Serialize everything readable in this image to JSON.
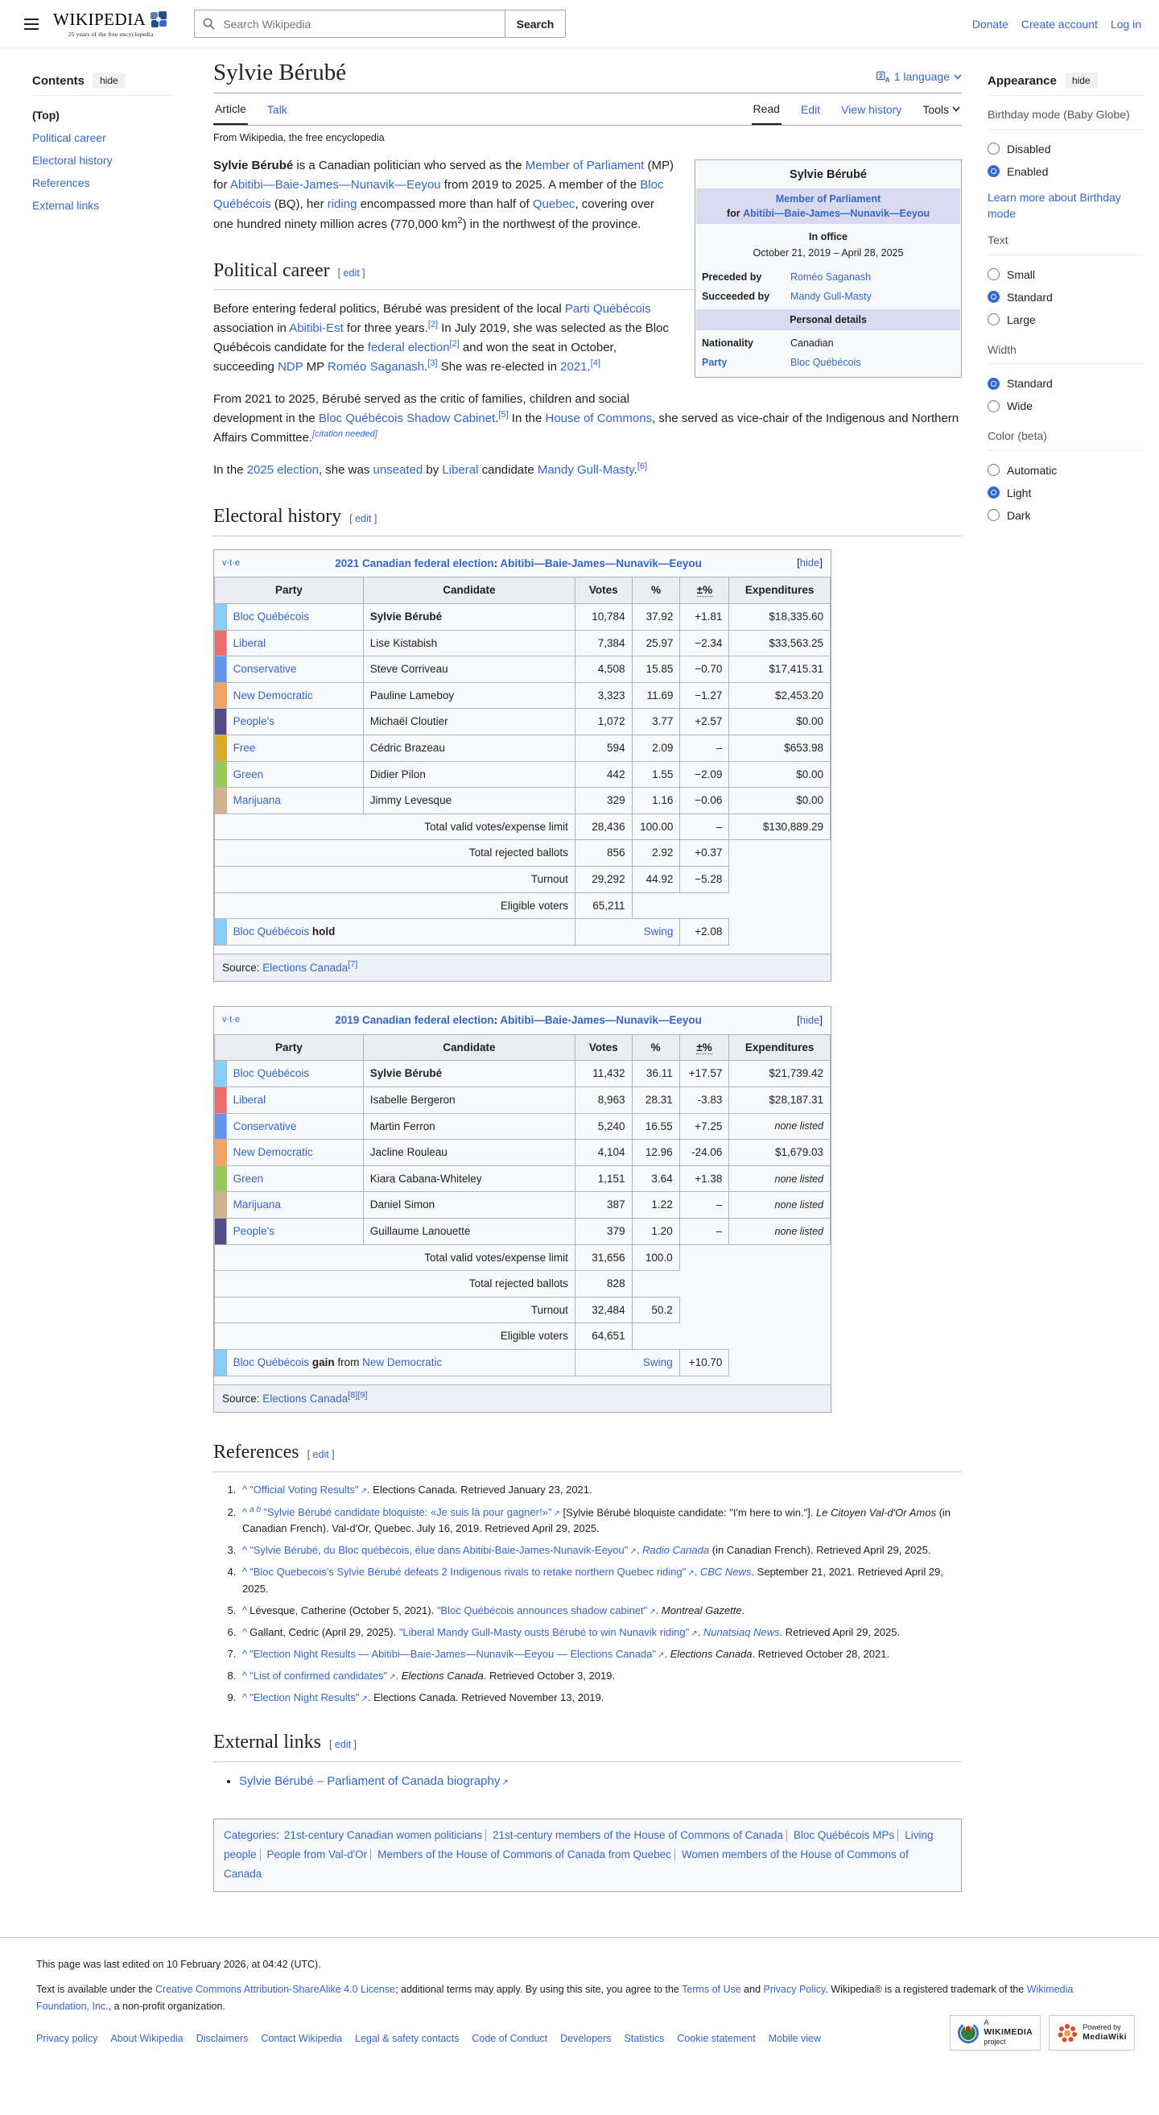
{
  "header": {
    "logo_word": "WIKIPEDIA",
    "logo_tagline": "25 years of the free encyclopedia",
    "search_placeholder": "Search Wikipedia",
    "search_button": "Search",
    "links": [
      "Donate",
      "Create account",
      "Log in"
    ]
  },
  "contents_sidebar": {
    "title": "Contents",
    "hide_label": "hide",
    "items": [
      {
        "label": "(Top)",
        "top": true
      },
      {
        "label": "Political career"
      },
      {
        "label": "Electoral history"
      },
      {
        "label": "References"
      },
      {
        "label": "External links"
      }
    ]
  },
  "article": {
    "title": "Sylvie Bérubé",
    "language_button": "1 language",
    "tabs_left": [
      "Article",
      "Talk"
    ],
    "tabs_right": [
      "Read",
      "Edit",
      "View history",
      "Tools"
    ],
    "subtitle": "From Wikipedia, the free encyclopedia",
    "edit_label": "edit",
    "sections": {
      "political_career": "Political career",
      "electoral_history": "Electoral history",
      "references": "References",
      "external_links": "External links"
    },
    "lead": [
      {
        "t": "b",
        "x": "Sylvie Bérubé"
      },
      {
        "t": "x",
        "x": " is a Canadian politician who served as the "
      },
      {
        "t": "l",
        "x": "Member of Parliament"
      },
      {
        "t": "x",
        "x": " (MP) for "
      },
      {
        "t": "l",
        "x": "Abitibi—Baie-James—Nunavik—Eeyou"
      },
      {
        "t": "x",
        "x": " from 2019 to 2025. A member of the "
      },
      {
        "t": "l",
        "x": "Bloc Québécois"
      },
      {
        "t": "x",
        "x": " (BQ), her "
      },
      {
        "t": "l",
        "x": "riding"
      },
      {
        "t": "x",
        "x": " encompassed more than half of "
      },
      {
        "t": "l",
        "x": "Quebec"
      },
      {
        "t": "x",
        "x": ", covering over one hundred ninety million acres (770,000 km"
      },
      {
        "t": "sp",
        "x": "2"
      },
      {
        "t": "x",
        "x": ") in the northwest of the province."
      }
    ],
    "career_paragraphs": [
      [
        {
          "t": "x",
          "x": "Before entering federal politics, Bérubé was president of the local "
        },
        {
          "t": "l",
          "x": "Parti Québécois"
        },
        {
          "t": "x",
          "x": " association in "
        },
        {
          "t": "l",
          "x": "Abitibi-Est"
        },
        {
          "t": "x",
          "x": " for three years."
        },
        {
          "t": "s",
          "x": "[2]"
        },
        {
          "t": "x",
          "x": " In July 2019, she was selected as the Bloc Québécois candidate for the "
        },
        {
          "t": "l",
          "x": "federal election"
        },
        {
          "t": "s",
          "x": "[2]"
        },
        {
          "t": "x",
          "x": " and won the seat in October, succeeding "
        },
        {
          "t": "l",
          "x": "NDP"
        },
        {
          "t": "x",
          "x": " MP "
        },
        {
          "t": "l",
          "x": "Roméo Saganash"
        },
        {
          "t": "x",
          "x": "."
        },
        {
          "t": "s",
          "x": "[3]"
        },
        {
          "t": "x",
          "x": " She was re-elected in "
        },
        {
          "t": "l",
          "x": "2021"
        },
        {
          "t": "x",
          "x": "."
        },
        {
          "t": "s",
          "x": "[4]"
        }
      ],
      [
        {
          "t": "x",
          "x": "From 2021 to 2025, Bérubé served as the critic of families, children and social development in the "
        },
        {
          "t": "l",
          "x": "Bloc Québécois Shadow Cabinet"
        },
        {
          "t": "x",
          "x": "."
        },
        {
          "t": "s",
          "x": "[5]"
        },
        {
          "t": "x",
          "x": " In the "
        },
        {
          "t": "l",
          "x": "House of Commons"
        },
        {
          "t": "x",
          "x": ", she served as vice-chair of the Indigenous and Northern Affairs Committee."
        },
        {
          "t": "scn",
          "x": "[citation needed]"
        }
      ],
      [
        {
          "t": "x",
          "x": "In the "
        },
        {
          "t": "l",
          "x": "2025 election"
        },
        {
          "t": "x",
          "x": ", she was "
        },
        {
          "t": "l",
          "x": "unseated"
        },
        {
          "t": "x",
          "x": " by "
        },
        {
          "t": "l",
          "x": "Liberal"
        },
        {
          "t": "x",
          "x": " candidate "
        },
        {
          "t": "l",
          "x": "Mandy Gull-Masty"
        },
        {
          "t": "x",
          "x": "."
        },
        {
          "t": "s",
          "x": "[6]"
        }
      ]
    ]
  },
  "infobox": {
    "name": "Sylvie Bérubé",
    "office_link": "Member of Parliament",
    "office_for": "for",
    "office_riding": "Abitibi—Baie-James—Nunavik—Eeyou",
    "in_office_label": "In office",
    "term": "October 21, 2019 – April 28, 2025",
    "rows": [
      {
        "label": "Preceded by",
        "label_link": false,
        "value": "Roméo Saganash",
        "value_link": true
      },
      {
        "label": "Succeeded by",
        "label_link": false,
        "value": "Mandy Gull-Masty",
        "value_link": true
      }
    ],
    "personal_details_header": "Personal details",
    "personal_rows": [
      {
        "label": "Nationality",
        "label_link": false,
        "value": "Canadian",
        "value_link": false
      },
      {
        "label": "Party",
        "label_link": true,
        "value": "Bloc Québécois",
        "value_link": true
      }
    ]
  },
  "elections": [
    {
      "vte": [
        "v",
        "t",
        "e"
      ],
      "vte_sep": "·",
      "title_election": "2021 Canadian federal election",
      "title_sep": ": ",
      "title_riding": "Abitibi—Baie-James—Nunavik—Eeyou",
      "hide_label": "hide",
      "columns": [
        "Party",
        "Candidate",
        "Votes",
        "%",
        "±%",
        "Expenditures"
      ],
      "rows": [
        {
          "color": "#87CEFA",
          "party": "Bloc Québécois",
          "candidate": "Sylvie Bérubé",
          "bold": true,
          "votes": "10,784",
          "pct": "37.92",
          "chg": "+1.81",
          "exp": "$18,335.60"
        },
        {
          "color": "#EA6D6A",
          "party": "Liberal",
          "candidate": "Lise Kistabish",
          "votes": "7,384",
          "pct": "25.97",
          "chg": "−2.34",
          "exp": "$33,563.25"
        },
        {
          "color": "#6495ED",
          "party": "Conservative",
          "candidate": "Steve Corriveau",
          "votes": "4,508",
          "pct": "15.85",
          "chg": "−0.70",
          "exp": "$17,415.31"
        },
        {
          "color": "#F4A460",
          "party": "New Democratic",
          "candidate": "Pauline Lameboy",
          "votes": "3,323",
          "pct": "11.69",
          "chg": "−1.27",
          "exp": "$2,453.20"
        },
        {
          "color": "#564986",
          "party": "People's",
          "candidate": "Michaël Cloutier",
          "votes": "1,072",
          "pct": "3.77",
          "chg": "+2.57",
          "exp": "$0.00"
        },
        {
          "color": "#D7AE23",
          "party": "Free",
          "candidate": "Cédric Brazeau",
          "votes": "594",
          "pct": "2.09",
          "chg": "–",
          "exp": "$653.98"
        },
        {
          "color": "#99C955",
          "party": "Green",
          "candidate": "Didier Pilon",
          "votes": "442",
          "pct": "1.55",
          "chg": "−2.09",
          "exp": "$0.00"
        },
        {
          "color": "#D2B48C",
          "party": "Marijuana",
          "candidate": "Jimmy Levesque",
          "votes": "329",
          "pct": "1.16",
          "chg": "−0.06",
          "exp": "$0.00"
        }
      ],
      "totals": [
        {
          "label": "Total valid votes/expense limit",
          "votes": "28,436",
          "pct": "100.00",
          "chg": "–",
          "exp": "$130,889.29"
        },
        {
          "label": "Total rejected ballots",
          "votes": "856",
          "pct": "2.92",
          "chg": "+0.37",
          "exp": null
        },
        {
          "label": "Turnout",
          "votes": "29,292",
          "pct": "44.92",
          "chg": "−5.28",
          "exp": null
        },
        {
          "label": "Eligible voters",
          "votes": "65,211",
          "pct": null,
          "chg": null,
          "exp": null
        }
      ],
      "result": {
        "color": "#87CEFA",
        "segments": [
          {
            "t": "l",
            "x": "Bloc Québécois"
          },
          {
            "t": "b",
            "x": " hold"
          }
        ],
        "swing_label": "Swing",
        "swing": "+2.08"
      },
      "source": [
        {
          "t": "x",
          "x": "Source: "
        },
        {
          "t": "l",
          "x": "Elections Canada"
        },
        {
          "t": "s",
          "x": "[7]"
        }
      ]
    },
    {
      "vte": [
        "v",
        "t",
        "e"
      ],
      "vte_sep": "·",
      "title_election": "2019 Canadian federal election",
      "title_sep": ": ",
      "title_riding": "Abitibi—Baie-James—Nunavik—Eeyou",
      "hide_label": "hide",
      "columns": [
        "Party",
        "Candidate",
        "Votes",
        "%",
        "±%",
        "Expenditures"
      ],
      "rows": [
        {
          "color": "#87CEFA",
          "party": "Bloc Québécois",
          "candidate": "Sylvie Bérubé",
          "bold": true,
          "votes": "11,432",
          "pct": "36.11",
          "chg": "+17.57",
          "exp": "$21,739.42"
        },
        {
          "color": "#EA6D6A",
          "party": "Liberal",
          "candidate": "Isabelle Bergeron",
          "votes": "8,963",
          "pct": "28.31",
          "chg": "-3.83",
          "exp": "$28,187.31"
        },
        {
          "color": "#6495ED",
          "party": "Conservative",
          "candidate": "Martin Ferron",
          "votes": "5,240",
          "pct": "16.55",
          "chg": "+7.25",
          "exp": "none listed"
        },
        {
          "color": "#F4A460",
          "party": "New Democratic",
          "candidate": "Jacline Rouleau",
          "votes": "4,104",
          "pct": "12.96",
          "chg": "-24.06",
          "exp": "$1,679.03"
        },
        {
          "color": "#99C955",
          "party": "Green",
          "candidate": "Kiara Cabana-Whiteley",
          "votes": "1,151",
          "pct": "3.64",
          "chg": "+1.38",
          "exp": "none listed"
        },
        {
          "color": "#D2B48C",
          "party": "Marijuana",
          "candidate": "Daniel Simon",
          "votes": "387",
          "pct": "1.22",
          "chg": "–",
          "exp": "none listed"
        },
        {
          "color": "#564986",
          "party": "People's",
          "candidate": "Guillaume Lanouette",
          "votes": "379",
          "pct": "1.20",
          "chg": "–",
          "exp": "none listed"
        }
      ],
      "totals": [
        {
          "label": "Total valid votes/expense limit",
          "votes": "31,656",
          "pct": "100.0",
          "chg": null,
          "exp": null
        },
        {
          "label": "Total rejected ballots",
          "votes": "828",
          "pct": null,
          "chg": null,
          "exp": null
        },
        {
          "label": "Turnout",
          "votes": "32,484",
          "pct": "50.2",
          "chg": null,
          "exp": null
        },
        {
          "label": "Eligible voters",
          "votes": "64,651",
          "pct": null,
          "chg": null,
          "exp": null
        }
      ],
      "result": {
        "color": "#87CEFA",
        "segments": [
          {
            "t": "l",
            "x": "Bloc Québécois"
          },
          {
            "t": "b",
            "x": " gain"
          },
          {
            "t": "x",
            "x": " from "
          },
          {
            "t": "l",
            "x": "New Democratic"
          }
        ],
        "swing_label": "Swing",
        "swing": "+10.70"
      },
      "source": [
        {
          "t": "x",
          "x": "Source: "
        },
        {
          "t": "l",
          "x": "Elections Canada"
        },
        {
          "t": "s",
          "x": "[8][9]"
        }
      ]
    }
  ],
  "references": [
    [
      {
        "t": "c",
        "x": "^"
      },
      {
        "t": "e",
        "x": "\"Official Voting Results\""
      },
      {
        "t": "x",
        "x": ". Elections Canada. Retrieved January 23, 2021."
      }
    ],
    [
      {
        "t": "c",
        "x": "^"
      },
      {
        "t": "ab",
        "x": "a b"
      },
      {
        "t": "e",
        "x": "\"Sylvie Bérubé candidate bloquiste: «Je suis là pour gagner!»\""
      },
      {
        "t": "x",
        "x": " [Sylvie Bérubé bloquiste candidate: \"I'm here to win.\"]. "
      },
      {
        "t": "i",
        "x": "Le Citoyen Val-d'Or Amos"
      },
      {
        "t": "x",
        "x": " (in Canadian French). Val-d'Or, Quebec. July 16, 2019. Retrieved April 29, 2025."
      }
    ],
    [
      {
        "t": "c",
        "x": "^"
      },
      {
        "t": "e",
        "x": "\"Sylvie Bérubé, du Bloc québécois, élue dans Abitibi-Baie-James-Nunavik-Eeyou\""
      },
      {
        "t": "x",
        "x": ". "
      },
      {
        "t": "il",
        "x": "Radio Canada"
      },
      {
        "t": "x",
        "x": " (in Canadian French). Retrieved April 29, 2025."
      }
    ],
    [
      {
        "t": "c",
        "x": "^"
      },
      {
        "t": "e",
        "x": "\"Bloc Quebecois's Sylvie Bérubé defeats 2 Indigenous rivals to retake northern Quebec riding\""
      },
      {
        "t": "x",
        "x": ". "
      },
      {
        "t": "il",
        "x": "CBC News"
      },
      {
        "t": "x",
        "x": ". September 21, 2021. Retrieved April 29, 2025."
      }
    ],
    [
      {
        "t": "c",
        "x": "^"
      },
      {
        "t": "x",
        "x": "Lévesque, Catherine (October 5, 2021). "
      },
      {
        "t": "e",
        "x": "\"Bloc Québécois announces shadow cabinet\""
      },
      {
        "t": "x",
        "x": ". "
      },
      {
        "t": "i",
        "x": "Montreal Gazette"
      },
      {
        "t": "x",
        "x": "."
      }
    ],
    [
      {
        "t": "c",
        "x": "^"
      },
      {
        "t": "x",
        "x": "Gallant, Cedric (April 29, 2025). "
      },
      {
        "t": "e",
        "x": "\"Liberal Mandy Gull-Masty ousts Bérubé to win Nunavik riding\""
      },
      {
        "t": "x",
        "x": ". "
      },
      {
        "t": "il",
        "x": "Nunatsiaq News"
      },
      {
        "t": "x",
        "x": ". Retrieved April 29, 2025."
      }
    ],
    [
      {
        "t": "c",
        "x": "^"
      },
      {
        "t": "e",
        "x": "\"Election Night Results — Abitibi—Baie-James—Nunavik—Eeyou — Elections Canada\""
      },
      {
        "t": "x",
        "x": ". "
      },
      {
        "t": "i",
        "x": "Elections Canada"
      },
      {
        "t": "x",
        "x": ". Retrieved October 28, 2021."
      }
    ],
    [
      {
        "t": "c",
        "x": "^"
      },
      {
        "t": "e",
        "x": "\"List of confirmed candidates\""
      },
      {
        "t": "x",
        "x": ". "
      },
      {
        "t": "i",
        "x": "Elections Canada"
      },
      {
        "t": "x",
        "x": ". Retrieved October 3, 2019."
      }
    ],
    [
      {
        "t": "c",
        "x": "^"
      },
      {
        "t": "e",
        "x": "\"Election Night Results\""
      },
      {
        "t": "x",
        "x": ". Elections Canada. Retrieved November 13, 2019."
      }
    ]
  ],
  "external_links_items": [
    [
      {
        "t": "e",
        "x": "Sylvie Bérubé – Parliament of Canada biography"
      }
    ]
  ],
  "categories": {
    "label": "Categories",
    "label_suffix": ": ",
    "items": [
      "21st-century Canadian women politicians",
      "21st-century members of the House of Commons of Canada",
      "Bloc Québécois MPs",
      "Living people",
      "People from Val-d'Or",
      "Members of the House of Commons of Canada from Quebec",
      "Women members of the House of Commons of Canada"
    ]
  },
  "appearance": {
    "title": "Appearance",
    "hide_label": "hide",
    "groups": [
      {
        "label": "Birthday mode (Baby Globe)",
        "options": [
          {
            "label": "Disabled",
            "checked": false
          },
          {
            "label": "Enabled",
            "checked": true
          }
        ],
        "link": "Learn more about Birthday mode"
      },
      {
        "label": "Text",
        "options": [
          {
            "label": "Small",
            "checked": false
          },
          {
            "label": "Standard",
            "checked": true
          },
          {
            "label": "Large",
            "checked": false
          }
        ]
      },
      {
        "label": "Width",
        "options": [
          {
            "label": "Standard",
            "checked": true
          },
          {
            "label": "Wide",
            "checked": false
          }
        ]
      },
      {
        "label": "Color (beta)",
        "options": [
          {
            "label": "Automatic",
            "checked": false
          },
          {
            "label": "Light",
            "checked": true
          },
          {
            "label": "Dark",
            "checked": false
          }
        ]
      }
    ]
  },
  "footer": {
    "last_edited": "This page was last edited on 10 February 2026, at 04:42 (UTC).",
    "license": [
      {
        "t": "x",
        "x": "Text is available under the "
      },
      {
        "t": "l",
        "x": "Creative Commons Attribution-ShareAlike 4.0 License"
      },
      {
        "t": "x",
        "x": "; additional terms may apply. By using this site, you agree to the "
      },
      {
        "t": "l",
        "x": "Terms of Use"
      },
      {
        "t": "x",
        "x": " and "
      },
      {
        "t": "l",
        "x": "Privacy Policy"
      },
      {
        "t": "x",
        "x": ". Wikipedia® is a registered trademark of the "
      },
      {
        "t": "l",
        "x": "Wikimedia Foundation, Inc."
      },
      {
        "t": "x",
        "x": ", a non-profit organization."
      }
    ],
    "links": [
      "Privacy policy",
      "About Wikipedia",
      "Disclaimers",
      "Contact Wikipedia",
      "Legal & safety contacts",
      "Code of Conduct",
      "Developers",
      "Statistics",
      "Cookie statement",
      "Mobile view"
    ],
    "badge_wikimedia": {
      "line1": "A",
      "line2": "WIKIMEDIA",
      "line3": "project"
    },
    "badge_mediawiki": {
      "line1": "Powered by",
      "line2": "MediaWiki"
    }
  }
}
